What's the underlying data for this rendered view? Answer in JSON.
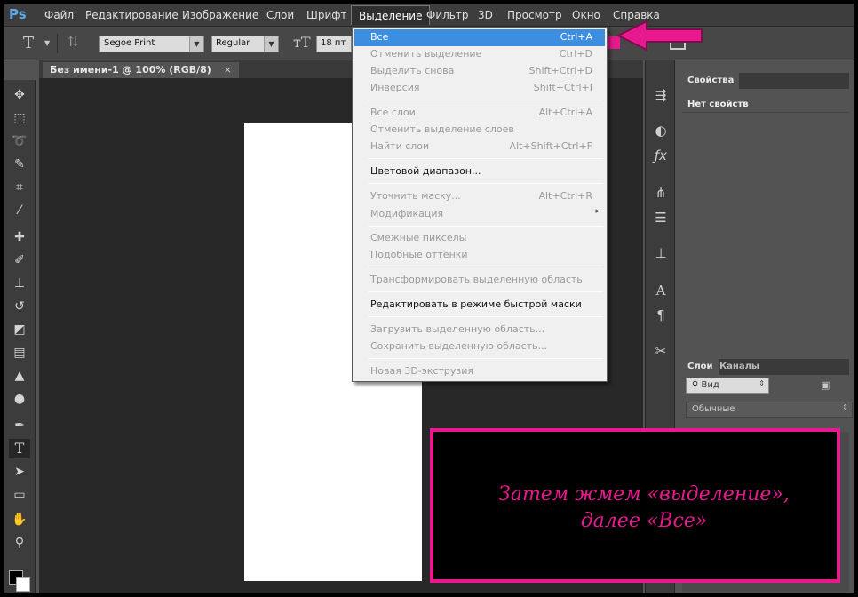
{
  "app": {
    "logo": "Ps"
  },
  "menubar": {
    "items": [
      {
        "label": "Файл"
      },
      {
        "label": "Редактирование"
      },
      {
        "label": "Изображение"
      },
      {
        "label": "Слои"
      },
      {
        "label": "Шрифт"
      },
      {
        "label": "Выделение"
      },
      {
        "label": "Фильтр"
      },
      {
        "label": "3D"
      },
      {
        "label": "Просмотр"
      },
      {
        "label": "Окно"
      },
      {
        "label": "Справка"
      }
    ],
    "active": "Выделение"
  },
  "options": {
    "font_family": "Segoe Print",
    "font_style": "Regular",
    "font_size": "18 пт",
    "text_color": "#e8198e"
  },
  "document_tab": {
    "title": "Без имени-1 @ 100% (RGB/8)",
    "close": "×"
  },
  "select_menu": {
    "items": [
      {
        "label": "Все",
        "shortcut": "Ctrl+A",
        "enabled": true,
        "highlighted": true
      },
      {
        "label": "Отменить выделение",
        "shortcut": "Ctrl+D",
        "enabled": false
      },
      {
        "label": "Выделить снова",
        "shortcut": "Shift+Ctrl+D",
        "enabled": false
      },
      {
        "label": "Инверсия",
        "shortcut": "Shift+Ctrl+I",
        "enabled": false
      },
      {
        "label": "Все слои",
        "shortcut": "Alt+Ctrl+A",
        "enabled": false
      },
      {
        "label": "Отменить выделение слоев",
        "shortcut": "",
        "enabled": false
      },
      {
        "label": "Найти слои",
        "shortcut": "Alt+Shift+Ctrl+F",
        "enabled": false
      },
      {
        "label": "Цветовой диапазон...",
        "shortcut": "",
        "enabled": true
      },
      {
        "label": "Уточнить маску...",
        "shortcut": "Alt+Ctrl+R",
        "enabled": false
      },
      {
        "label": "Модификация",
        "shortcut": "",
        "enabled": false,
        "submenu": "▸"
      },
      {
        "label": "Смежные пикселы",
        "shortcut": "",
        "enabled": false
      },
      {
        "label": "Подобные оттенки",
        "shortcut": "",
        "enabled": false
      },
      {
        "label": "Трансформировать выделенную область",
        "shortcut": "",
        "enabled": false
      },
      {
        "label": "Редактировать в режиме быстрой маски",
        "shortcut": "",
        "enabled": true
      },
      {
        "label": "Загрузить выделенную область...",
        "shortcut": "",
        "enabled": false
      },
      {
        "label": "Сохранить выделенную область...",
        "shortcut": "",
        "enabled": false
      },
      {
        "label": "Новая 3D-экструзия",
        "shortcut": "",
        "enabled": false
      }
    ]
  },
  "properties_panel": {
    "tab": "Свойства",
    "empty_text": "Нет свойств"
  },
  "layers_panel": {
    "tabs": [
      "Слои",
      "Каналы"
    ],
    "filter_label": "Вид",
    "blend_mode": "Обычные"
  },
  "annotation": {
    "line1": "Затем жмем «выделение»,",
    "line2": "далее «Все»",
    "color": "#e8198e"
  },
  "icons": {
    "tools": [
      "move-icon",
      "marquee-icon",
      "lasso-icon",
      "quick-select-icon",
      "crop-icon",
      "eyedropper-icon",
      "healing-icon",
      "brush-icon",
      "stamp-icon",
      "history-brush-icon",
      "eraser-icon",
      "gradient-icon",
      "blur-icon",
      "dodge-icon",
      "pen-icon",
      "type-icon",
      "path-select-icon",
      "shape-icon",
      "hand-icon",
      "zoom-icon"
    ]
  }
}
